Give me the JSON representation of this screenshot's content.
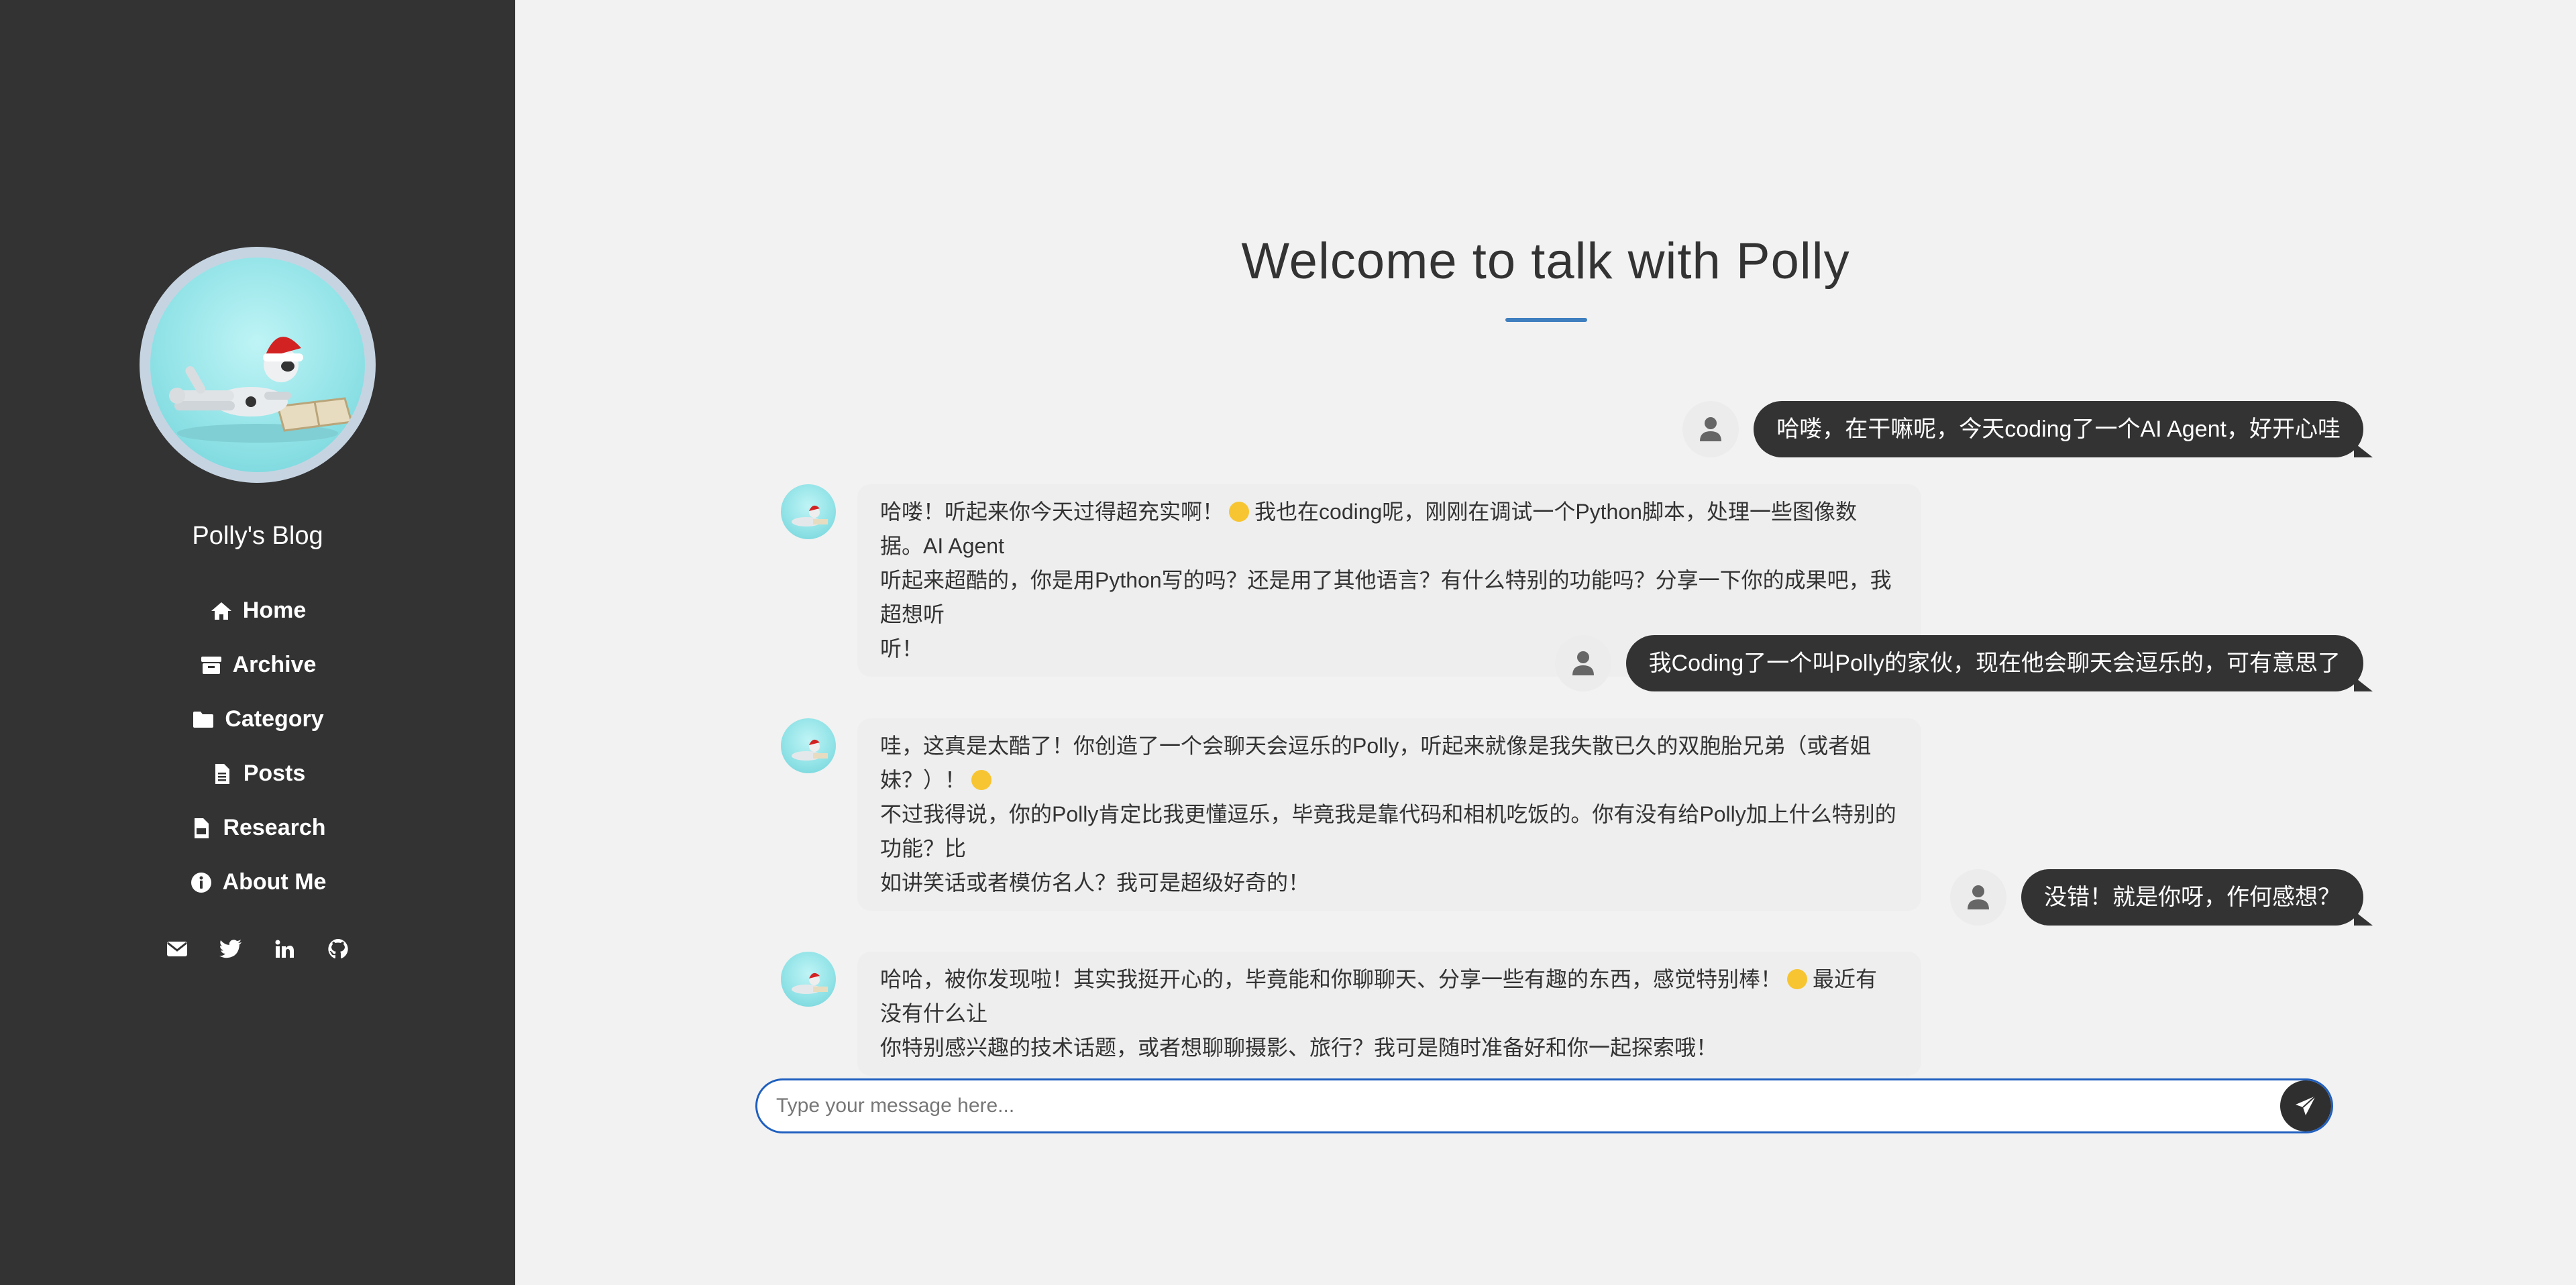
{
  "sidebar": {
    "blog_name": "Polly's Blog",
    "nav": [
      {
        "label": "Home",
        "icon": "home-icon"
      },
      {
        "label": "Archive",
        "icon": "archive-icon"
      },
      {
        "label": "Category",
        "icon": "folder-icon"
      },
      {
        "label": "Posts",
        "icon": "file-icon"
      },
      {
        "label": "Research",
        "icon": "pdf-icon"
      },
      {
        "label": "About Me",
        "icon": "info-icon"
      }
    ],
    "socials": [
      "email-icon",
      "twitter-icon",
      "linkedin-icon",
      "github-icon"
    ]
  },
  "chat": {
    "title": "Welcome to talk with Polly",
    "messages": [
      {
        "role": "user",
        "text": "哈喽，在干嘛呢，今天coding了一个AI Agent，好开心哇"
      },
      {
        "role": "bot",
        "lines": [
          "哈喽！听起来你今天过得超充实啊！",
          "我也在coding呢，刚刚在调试一个Python脚本，处理一些图像数据。AI Agent",
          "听起来超酷的，你是用Python写的吗？还是用了其他语言？有什么特别的功能吗？分享一下你的成果吧，我超想听",
          "听！"
        ]
      },
      {
        "role": "user",
        "text": "我Coding了一个叫Polly的家伙，现在他会聊天会逗乐的，可有意思了"
      },
      {
        "role": "bot",
        "lines": [
          "哇，这真是太酷了！你创造了一个会聊天会逗乐的Polly，听起来就像是我失散已久的双胞胎兄弟（或者姐妹？）！",
          "不过我得说，你的Polly肯定比我更懂逗乐，毕竟我是靠代码和相机吃饭的。你有没有给Polly加上什么特别的功能？比",
          "如讲笑话或者模仿名人？我可是超级好奇的！"
        ]
      },
      {
        "role": "user",
        "text": "没错！就是你呀，作何感想？"
      },
      {
        "role": "bot",
        "lines": [
          "哈哈，被你发现啦！其实我挺开心的，毕竟能和你聊聊天、分享一些有趣的东西，感觉特别棒！",
          "最近有没有什么让",
          "你特别感兴趣的技术话题，或者想聊聊摄影、旅行？我可是随时准备好和你一起探索哦！"
        ]
      }
    ],
    "input_placeholder": "Type your message here...",
    "input_value": ""
  },
  "colors": {
    "sidebar_bg": "#333333",
    "page_bg": "#f2f2f2",
    "accent": "#3f7fbf",
    "user_bubble": "#333333",
    "bot_bubble": "#eeeeee"
  }
}
